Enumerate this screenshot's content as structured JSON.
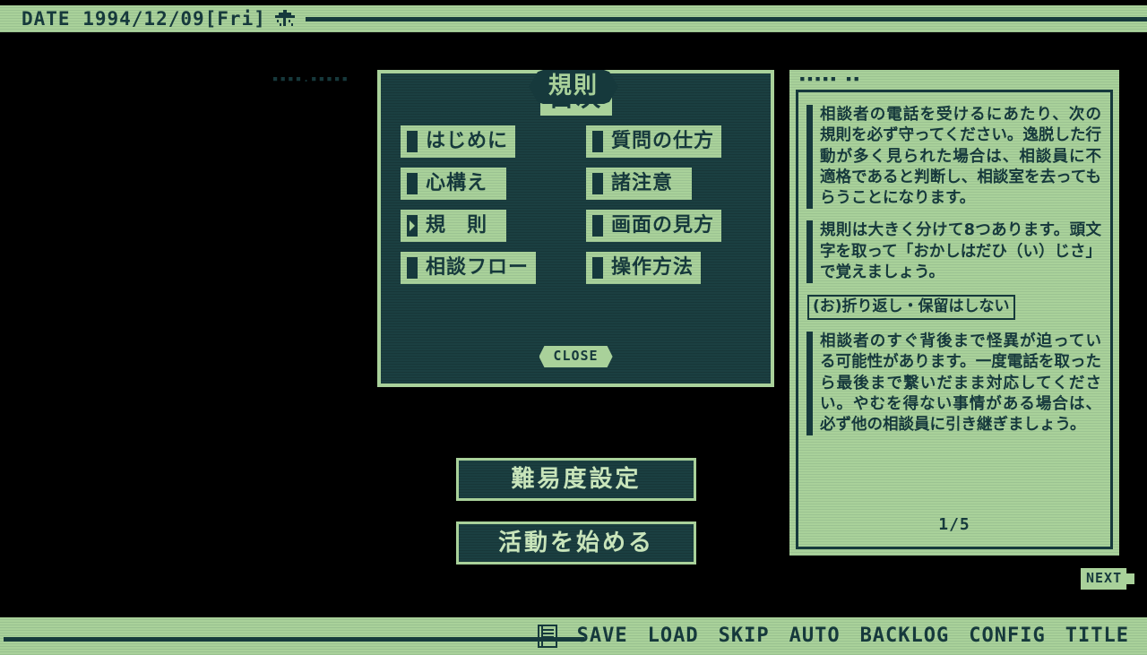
{
  "colors": {
    "light_green": "#a9d19a",
    "deep_teal": "#16393c",
    "panel_dark": "#1b3f41",
    "button_text": "#c8e4ba",
    "background": "#000000"
  },
  "status_bar": {
    "date_text": "DATE 1994/12/09[Fri]",
    "weather_icon": "rain-icon"
  },
  "index_panel": {
    "title": "目次",
    "items": [
      {
        "label": "はじめに",
        "selected": false
      },
      {
        "label": "質問の仕方",
        "selected": false
      },
      {
        "label": "心構え",
        "selected": false
      },
      {
        "label": "諸注意",
        "selected": false
      },
      {
        "label": "規　則",
        "selected": true
      },
      {
        "label": "画面の見方",
        "selected": false
      },
      {
        "label": "相談フロー",
        "selected": false
      },
      {
        "label": "操作方法",
        "selected": false
      }
    ],
    "close_label": "CLOSE"
  },
  "actions": {
    "difficulty_label": "難易度設定",
    "start_label": "活動を始める"
  },
  "rules_panel": {
    "title": "規則",
    "deco_left": "▪▪▪▪▪ ▪▪",
    "deco_right": "▪▪▪▪.▪▪▪▪▪",
    "paragraphs": [
      "相談者の電話を受けるにあたり、次の規則を必ず守ってください。逸脱した行動が多く見られた場合は、相談員に不適格であると判断し、相談室を去ってもらうことになります。",
      "規則は大きく分けて8つあります。頭文字を取って「おかしはだひ（い）じさ」で覚えましょう。"
    ],
    "section_heading": "(お)折り返し・保留はしない",
    "section_body": "相談者のすぐ背後まで怪異が迫っている可能性があります。一度電話を取ったら最後まで繋いだまま対応してください。やむを得ない事情がある場合は、必ず他の相談員に引き継ぎましょう。",
    "page_indicator": "1/5",
    "next_label": "NEXT"
  },
  "command_bar": {
    "menu_icon": "list-icon",
    "items": [
      {
        "label": "SAVE"
      },
      {
        "label": "LOAD"
      },
      {
        "label": "SKIP"
      },
      {
        "label": "AUTO"
      },
      {
        "label": "BACKLOG"
      },
      {
        "label": "CONFIG"
      },
      {
        "label": "TITLE"
      }
    ]
  }
}
